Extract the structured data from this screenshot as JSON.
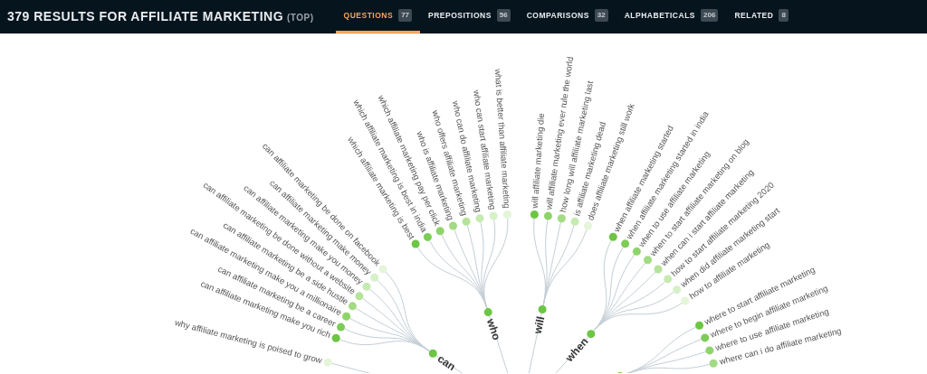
{
  "header": {
    "title": "379 RESULTS FOR AFFILIATE MARKETING",
    "scope": "(TOP)"
  },
  "tabs": [
    {
      "label": "QUESTIONS",
      "count": "77",
      "selected": true
    },
    {
      "label": "PREPOSITIONS",
      "count": "56",
      "selected": false
    },
    {
      "label": "COMPARISONS",
      "count": "32",
      "selected": false
    },
    {
      "label": "ALPHABETICALS",
      "count": "206",
      "selected": false
    },
    {
      "label": "RELATED",
      "count": "8",
      "selected": false
    }
  ],
  "wheel": {
    "branches": [
      {
        "children": [
          {
            "label": "why affiliate marketing is poised to grow",
            "color": "#e4f5da"
          }
        ]
      },
      {
        "label": "can",
        "children": [
          {
            "label": "can affiliate marketing make you rich",
            "color": "#6cc644"
          },
          {
            "label": "can affiliate marketing be a career",
            "color": "#7ccd55"
          },
          {
            "label": "can affiliate marketing make you a millionaire",
            "color": "#8fd46b"
          },
          {
            "label": "can affiliate marketing be a side hustle",
            "color": "#a2db82"
          },
          {
            "label": "can affiliate marketing be done without a website",
            "color": "#b5e39a"
          },
          {
            "label": "can affiliate marketing make you money",
            "color": "#c6eab1"
          },
          {
            "label": "can affiliate marketing make money",
            "color": "#d6f0c8"
          },
          {
            "label": "can affiliate marketing be done on facebook",
            "color": "#e4f5da"
          }
        ]
      },
      {
        "label": "who",
        "children": [
          {
            "label": "which affiliate marketing is best",
            "color": "#6cc644"
          },
          {
            "label": "which affiliate marketing is best in india",
            "color": "#7ccd55"
          },
          {
            "label": "which affiliate marketing pay per click",
            "color": "#8fd46b"
          },
          {
            "label": "who is affiliate marketing",
            "color": "#a2db82"
          },
          {
            "label": "who offers affiliate marketing",
            "color": "#b5e39a"
          },
          {
            "label": "who can do affiliate marketing",
            "color": "#c6eab1"
          },
          {
            "label": "who can start affiliate marketing",
            "color": "#d6f0c8"
          },
          {
            "label": "what is better than affiliate marketing",
            "color": "#e4f5da"
          }
        ]
      },
      {
        "label": "will",
        "children": [
          {
            "label": "will affiliate marketing die",
            "color": "#6cc644"
          },
          {
            "label": "will affiliate marketing ever rule the world",
            "color": "#8fd46b"
          },
          {
            "label": "how long will affiliate marketing last",
            "color": "#a2db82"
          },
          {
            "label": "is affiliate marketing dead",
            "color": "#c6eab1"
          },
          {
            "label": "does affiliate marketing still work",
            "color": "#e4f5da"
          }
        ]
      },
      {
        "label": "when",
        "children": [
          {
            "label": "when affiliate marketing started",
            "color": "#6cc644"
          },
          {
            "label": "when affiliate marketing started in india",
            "color": "#7ccd55"
          },
          {
            "label": "when to use affiliate marketing",
            "color": "#8fd46b"
          },
          {
            "label": "when to start affiliate marketing on blog",
            "color": "#a2db82"
          },
          {
            "label": "when can i start affiliate marketing",
            "color": "#b5e39a"
          },
          {
            "label": "how to start affiliate marketing 2020",
            "color": "#c6eab1"
          },
          {
            "label": "when did affiliate marketing start",
            "color": "#d6f0c8"
          },
          {
            "label": "how to affiliate marketing",
            "color": "#e4f5da"
          }
        ]
      },
      {
        "children": [
          {
            "label": "where to start affiliate marketing",
            "color": "#6cc644"
          },
          {
            "label": "where to begin affiliate marketing",
            "color": "#7ccd55"
          },
          {
            "label": "where to use affiliate marketing",
            "color": "#8fd46b"
          },
          {
            "label": "where can i do affiliate marketing",
            "color": "#a2db82"
          }
        ]
      }
    ]
  }
}
